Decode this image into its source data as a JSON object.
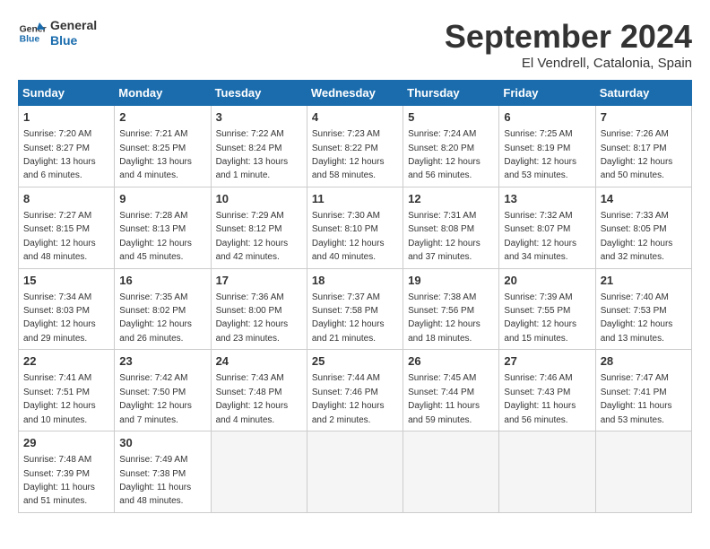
{
  "logo": {
    "line1": "General",
    "line2": "Blue"
  },
  "title": "September 2024",
  "subtitle": "El Vendrell, Catalonia, Spain",
  "days_of_week": [
    "Sunday",
    "Monday",
    "Tuesday",
    "Wednesday",
    "Thursday",
    "Friday",
    "Saturday"
  ],
  "weeks": [
    [
      {
        "day": "1",
        "sunrise": "7:20 AM",
        "sunset": "8:27 PM",
        "daylight": "13 hours and 6 minutes."
      },
      {
        "day": "2",
        "sunrise": "7:21 AM",
        "sunset": "8:25 PM",
        "daylight": "13 hours and 4 minutes."
      },
      {
        "day": "3",
        "sunrise": "7:22 AM",
        "sunset": "8:24 PM",
        "daylight": "13 hours and 1 minute."
      },
      {
        "day": "4",
        "sunrise": "7:23 AM",
        "sunset": "8:22 PM",
        "daylight": "12 hours and 58 minutes."
      },
      {
        "day": "5",
        "sunrise": "7:24 AM",
        "sunset": "8:20 PM",
        "daylight": "12 hours and 56 minutes."
      },
      {
        "day": "6",
        "sunrise": "7:25 AM",
        "sunset": "8:19 PM",
        "daylight": "12 hours and 53 minutes."
      },
      {
        "day": "7",
        "sunrise": "7:26 AM",
        "sunset": "8:17 PM",
        "daylight": "12 hours and 50 minutes."
      }
    ],
    [
      {
        "day": "8",
        "sunrise": "7:27 AM",
        "sunset": "8:15 PM",
        "daylight": "12 hours and 48 minutes."
      },
      {
        "day": "9",
        "sunrise": "7:28 AM",
        "sunset": "8:13 PM",
        "daylight": "12 hours and 45 minutes."
      },
      {
        "day": "10",
        "sunrise": "7:29 AM",
        "sunset": "8:12 PM",
        "daylight": "12 hours and 42 minutes."
      },
      {
        "day": "11",
        "sunrise": "7:30 AM",
        "sunset": "8:10 PM",
        "daylight": "12 hours and 40 minutes."
      },
      {
        "day": "12",
        "sunrise": "7:31 AM",
        "sunset": "8:08 PM",
        "daylight": "12 hours and 37 minutes."
      },
      {
        "day": "13",
        "sunrise": "7:32 AM",
        "sunset": "8:07 PM",
        "daylight": "12 hours and 34 minutes."
      },
      {
        "day": "14",
        "sunrise": "7:33 AM",
        "sunset": "8:05 PM",
        "daylight": "12 hours and 32 minutes."
      }
    ],
    [
      {
        "day": "15",
        "sunrise": "7:34 AM",
        "sunset": "8:03 PM",
        "daylight": "12 hours and 29 minutes."
      },
      {
        "day": "16",
        "sunrise": "7:35 AM",
        "sunset": "8:02 PM",
        "daylight": "12 hours and 26 minutes."
      },
      {
        "day": "17",
        "sunrise": "7:36 AM",
        "sunset": "8:00 PM",
        "daylight": "12 hours and 23 minutes."
      },
      {
        "day": "18",
        "sunrise": "7:37 AM",
        "sunset": "7:58 PM",
        "daylight": "12 hours and 21 minutes."
      },
      {
        "day": "19",
        "sunrise": "7:38 AM",
        "sunset": "7:56 PM",
        "daylight": "12 hours and 18 minutes."
      },
      {
        "day": "20",
        "sunrise": "7:39 AM",
        "sunset": "7:55 PM",
        "daylight": "12 hours and 15 minutes."
      },
      {
        "day": "21",
        "sunrise": "7:40 AM",
        "sunset": "7:53 PM",
        "daylight": "12 hours and 13 minutes."
      }
    ],
    [
      {
        "day": "22",
        "sunrise": "7:41 AM",
        "sunset": "7:51 PM",
        "daylight": "12 hours and 10 minutes."
      },
      {
        "day": "23",
        "sunrise": "7:42 AM",
        "sunset": "7:50 PM",
        "daylight": "12 hours and 7 minutes."
      },
      {
        "day": "24",
        "sunrise": "7:43 AM",
        "sunset": "7:48 PM",
        "daylight": "12 hours and 4 minutes."
      },
      {
        "day": "25",
        "sunrise": "7:44 AM",
        "sunset": "7:46 PM",
        "daylight": "12 hours and 2 minutes."
      },
      {
        "day": "26",
        "sunrise": "7:45 AM",
        "sunset": "7:44 PM",
        "daylight": "11 hours and 59 minutes."
      },
      {
        "day": "27",
        "sunrise": "7:46 AM",
        "sunset": "7:43 PM",
        "daylight": "11 hours and 56 minutes."
      },
      {
        "day": "28",
        "sunrise": "7:47 AM",
        "sunset": "7:41 PM",
        "daylight": "11 hours and 53 minutes."
      }
    ],
    [
      {
        "day": "29",
        "sunrise": "7:48 AM",
        "sunset": "7:39 PM",
        "daylight": "11 hours and 51 minutes."
      },
      {
        "day": "30",
        "sunrise": "7:49 AM",
        "sunset": "7:38 PM",
        "daylight": "11 hours and 48 minutes."
      },
      null,
      null,
      null,
      null,
      null
    ]
  ]
}
